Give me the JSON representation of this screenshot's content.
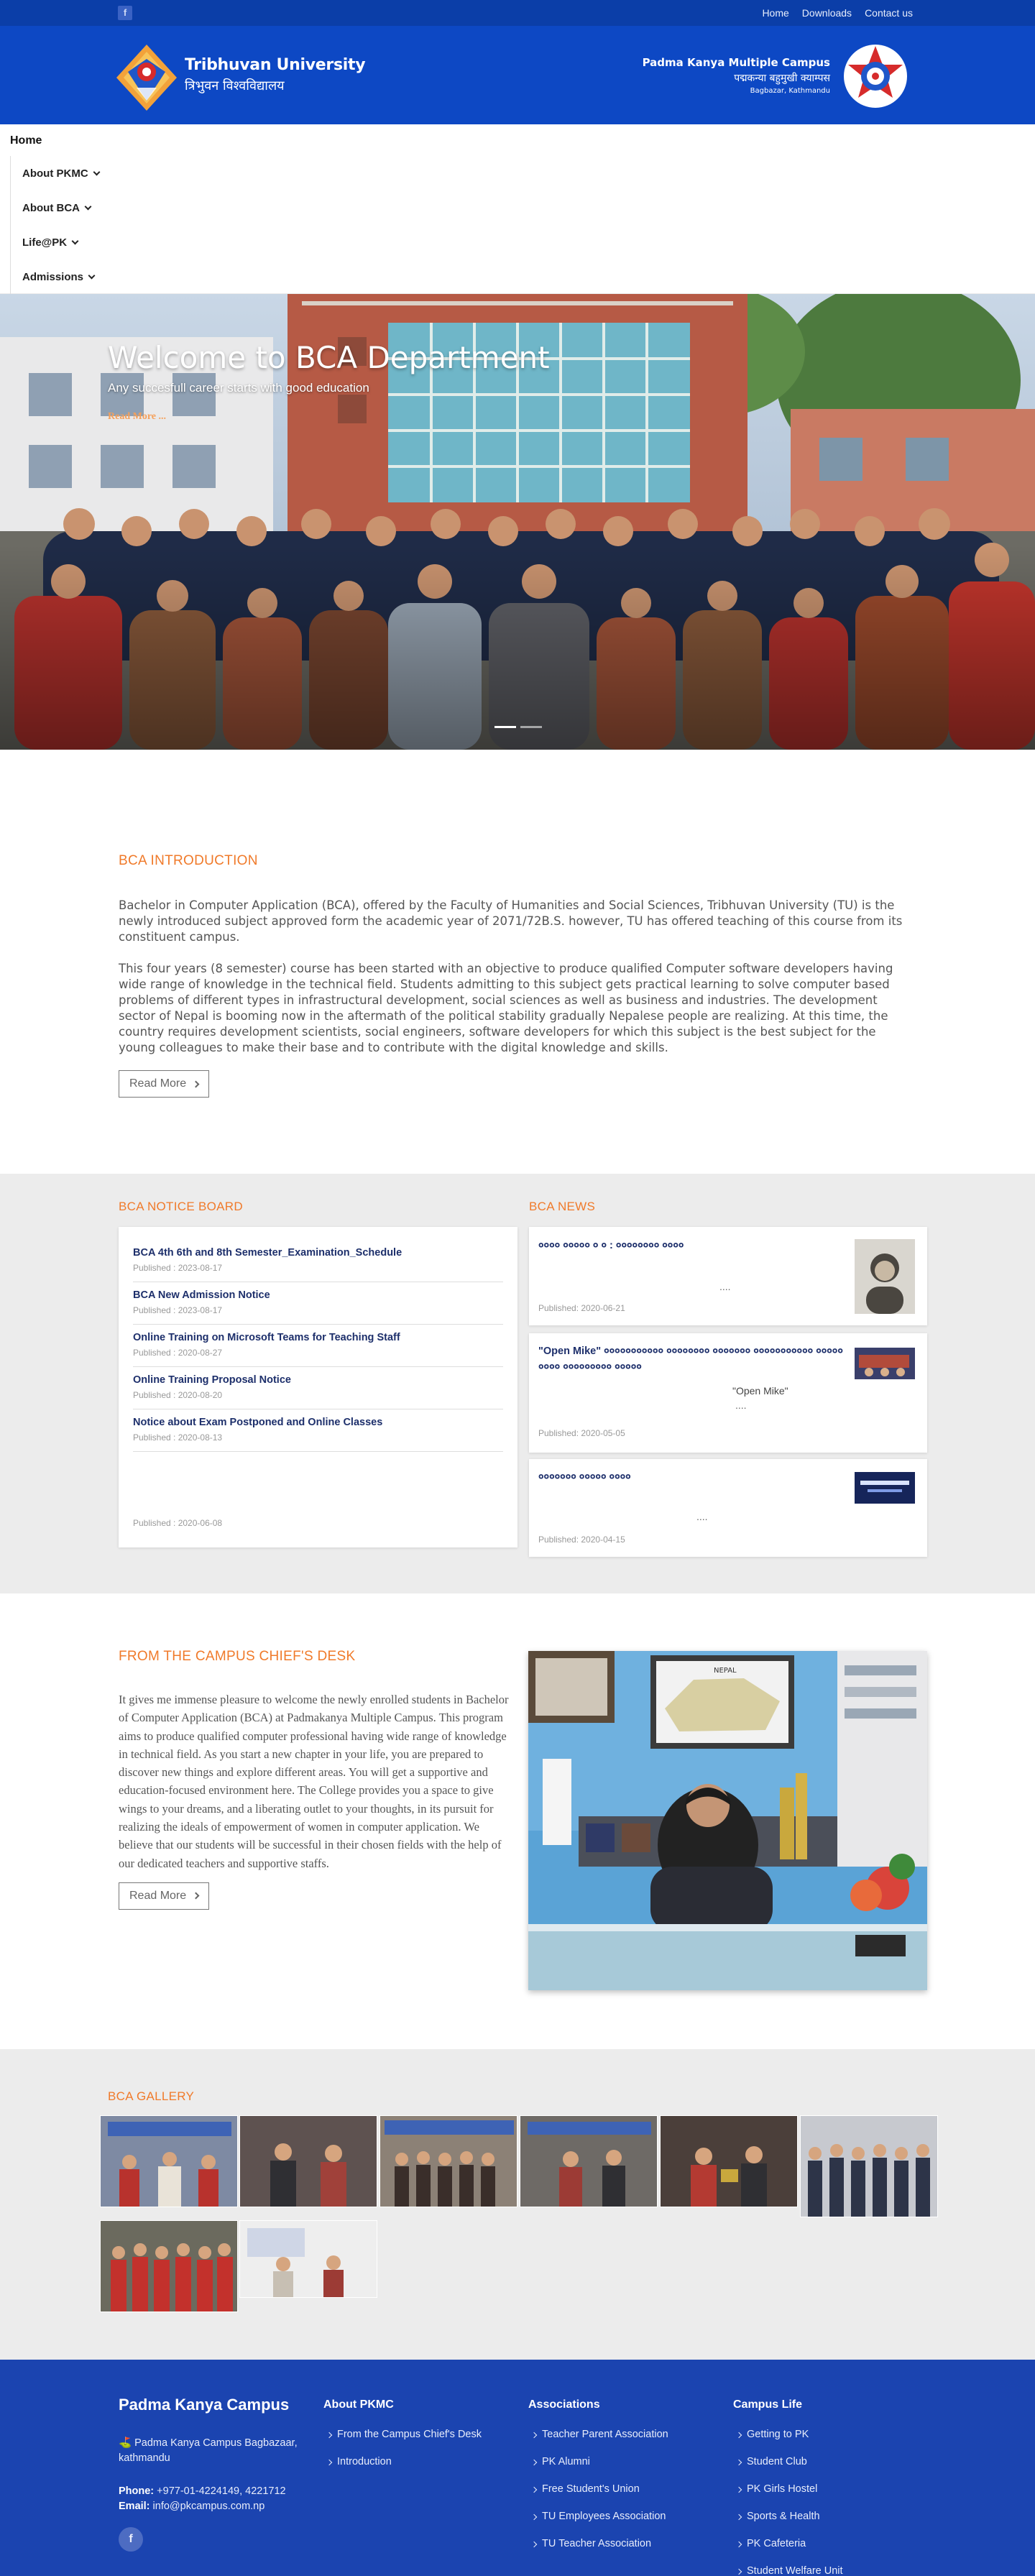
{
  "topbar": {
    "facebook_icon": "facebook-icon",
    "links": [
      "Home",
      "Downloads",
      "Contact us"
    ]
  },
  "header": {
    "tu_name_en": "Tribhuvan University",
    "tu_name_np": "त्रिभुवन विश्वविद्यालय",
    "campus_name_en": "Padma Kanya Multiple Campus",
    "campus_name_np": "पद्मकन्या बहुमुखी क्याम्पस",
    "campus_location": "Bagbazar, Kathmandu"
  },
  "nav": {
    "home": "Home",
    "items": [
      "About PKMC",
      "About BCA",
      "Life@PK",
      "Admissions"
    ]
  },
  "hero": {
    "title": "Welcome to BCA Department",
    "subtitle": "Any succesfull career starts with good education",
    "read_more": "Read More ..."
  },
  "intro": {
    "title": "BCA INTRODUCTION",
    "p1": "Bachelor in Computer Application (BCA), offered by the Faculty of Humanities and Social Sciences, Tribhuvan University (TU) is the newly introduced subject approved form the academic year of 2071/72B.S. however, TU has offered teaching of this course from its constituent campus.",
    "p2": "This four years (8 semester) course has been started with an objective to produce qualified Computer software developers having wide range of knowledge in the technical field. Students admitting to this subject gets practical learning to solve computer based problems of different types in infrastructural development, social sciences as well as business and industries. The development sector of Nepal is booming now in the aftermath of the political stability gradually Nepalese people are realizing. At this time, the country requires development scientists, social engineers, software developers for which this subject is the best subject for the  young colleagues to make their base and to contribute with the digital knowledge and skills.",
    "button": "Read More"
  },
  "notices": {
    "title": "BCA NOTICE BOARD",
    "items": [
      {
        "title": "BCA 4th 6th and 8th Semester_Examination_Schedule",
        "date": "Published : 2023-08-17"
      },
      {
        "title": "BCA New Admission Notice",
        "date": "Published : 2023-08-17"
      },
      {
        "title": "Online Training on Microsoft Teams for Teaching Staff",
        "date": "Published : 2020-08-27"
      },
      {
        "title": "Online Training Proposal Notice",
        "date": "Published : 2020-08-20"
      },
      {
        "title": "Notice about Exam Postponed and Online Classes",
        "date": "Published : 2020-08-13"
      }
    ],
    "last_date": "Published : 2020-06-08"
  },
  "news": {
    "title": "BCA NEWS",
    "items": [
      {
        "title": "०००० ००००० ० ० : ०००००००० ००००",
        "ellipsis": "....",
        "date": "Published: 2020-06-21"
      },
      {
        "title": "\"Open Mike\" ००००००००००० ०००००००० ००००००० ००००००००००० ००००० ०००० ००००००००० ०००००",
        "quote": "\"Open Mike\"",
        "ellipsis": "....",
        "date": "Published: 2020-05-05"
      },
      {
        "title": "००००००० ००००० ००००",
        "ellipsis": "....",
        "date": "Published: 2020-04-15"
      }
    ]
  },
  "chief": {
    "title": "FROM THE CAMPUS CHIEF'S DESK",
    "text": "It gives me immense pleasure to welcome the newly enrolled students in Bachelor of Computer Application (BCA) at Padmakanya Multiple Campus. This program aims to produce qualified computer professional having wide range of knowledge in technical field. As you start a new chapter in your life, you are prepared to discover new things and explore different areas. You will get a supportive and education-focused environment here. The College provides you a space to give wings to your dreams, and a liberating outlet to your thoughts, in its pursuit for realizing the ideals of empowerment of women in computer application. We believe that our students will be successful in their chosen fields with the help of our dedicated teachers and supportive staffs.",
    "button": "Read More",
    "photo_label": "NEPAL"
  },
  "gallery": {
    "title": "BCA GALLERY"
  },
  "footer": {
    "name": "Padma Kanya Campus",
    "address": "Padma Kanya Campus Bagbazaar, kathmandu",
    "phone_label": "Phone:",
    "phone": "+977-01-4224149, 4221712",
    "email_label": "Email:",
    "email": "info@pkcampus.com.np",
    "columns": [
      {
        "title": "About PKMC",
        "links": [
          "From the Campus Chief's Desk",
          "Introduction"
        ]
      },
      {
        "title": "Associations",
        "links": [
          "Teacher Parent Association",
          "PK Alumni",
          "Free Student's Union",
          "TU Employees Association",
          "TU Teacher Association"
        ]
      },
      {
        "title": "Campus Life",
        "links": [
          "Getting to PK",
          "Student Club",
          "PK Girls Hostel",
          "Sports & Health",
          "PK Cafeteria",
          "Student Welfare Unit"
        ]
      }
    ]
  },
  "colors": {
    "primary_blue": "#0d48c4",
    "topbar_blue": "#0b3ea8",
    "accent_orange": "#f07a2a",
    "footer_blue": "#1b44b0"
  }
}
